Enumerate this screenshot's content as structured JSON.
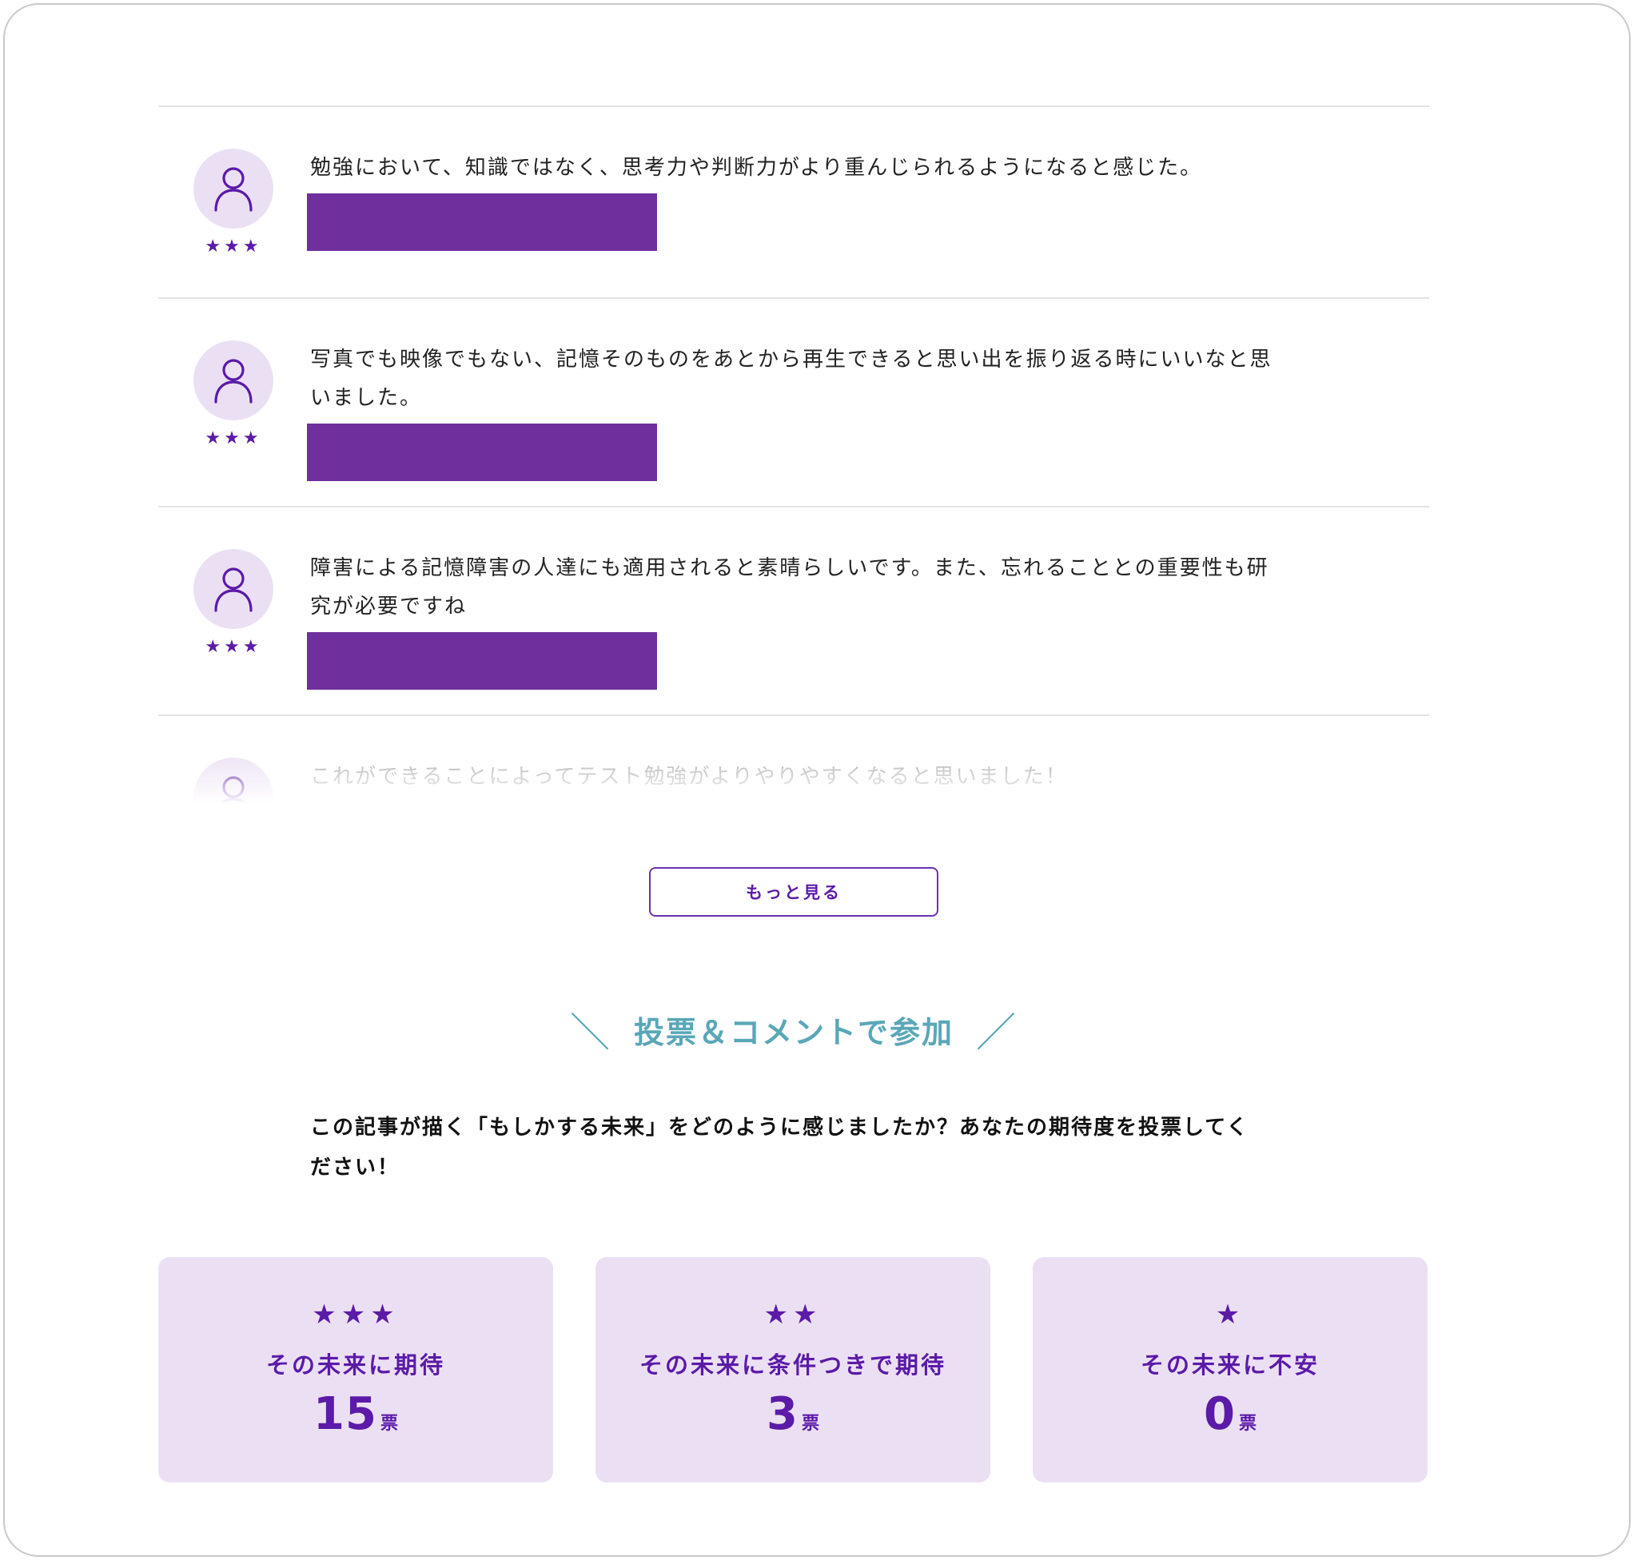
{
  "comments": [
    {
      "text": "勉強において、知識ではなく、思考力や判断力がより重んじられるようになると感じた。",
      "stars": "★★★"
    },
    {
      "text": "写真でも映像でもない、記憶そのものをあとから再生できると思い出を振り返る時にいいなと思いました。",
      "stars": "★★★"
    },
    {
      "text": "障害による記憶障害の人達にも適用されると素晴らしいです。また、忘れることとの重要性も研究が必要ですね",
      "stars": "★★★"
    },
    {
      "text": "これができることによってテスト勉強がよりやりやすくなると思いました！",
      "stars": "★★★"
    }
  ],
  "more_button": {
    "label": "もっと見る"
  },
  "section": {
    "title": "投票＆コメントで参加",
    "slash_left": "＼",
    "slash_right": "／",
    "prompt": "この記事が描く「もしかする未来」をどのように感じましたか？あなたの期待度を投票してください！"
  },
  "votes": [
    {
      "stars": "★★★",
      "label": "その未来に期待",
      "count": "15",
      "unit": "票"
    },
    {
      "stars": "★★",
      "label": "その未来に条件つきで期待",
      "count": "3",
      "unit": "票"
    },
    {
      "stars": "★",
      "label": "その未来に不安",
      "count": "0",
      "unit": "票"
    }
  ],
  "colors": {
    "accent": "#5b1aa8",
    "reply_bar": "#6f2f9c",
    "avatar_bg": "#ebe0f3",
    "card_bg": "#ebe0f3",
    "heading": "#5aa7b8",
    "divider": "#e3e3e3"
  },
  "icons": {
    "avatar": "user-icon",
    "rating": "star-icon"
  }
}
